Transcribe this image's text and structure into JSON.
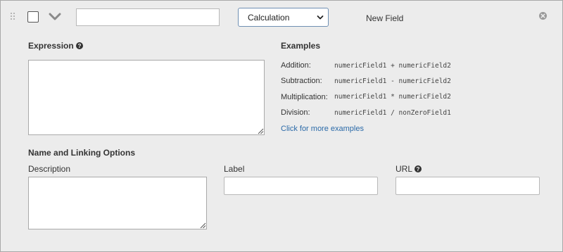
{
  "header": {
    "name_value": "",
    "type_selected": "Calculation",
    "field_title": "New Field"
  },
  "expression": {
    "label": "Expression",
    "value": ""
  },
  "examples": {
    "title": "Examples",
    "items": [
      {
        "label": "Addition:",
        "code": "numericField1 + numericField2"
      },
      {
        "label": "Subtraction:",
        "code": "numericField1 - numericField2"
      },
      {
        "label": "Multiplication:",
        "code": "numericField1 * numericField2"
      },
      {
        "label": "Division:",
        "code": "numericField1 / nonZeroField1"
      }
    ],
    "more_link": "Click for more examples"
  },
  "linking": {
    "title": "Name and Linking Options",
    "description_label": "Description",
    "description_value": "",
    "label_label": "Label",
    "label_value": "",
    "url_label": "URL",
    "url_value": ""
  },
  "colors": {
    "panel_bg": "#ececec",
    "link": "#2b6aa8",
    "select_border": "#6f8fb3"
  }
}
